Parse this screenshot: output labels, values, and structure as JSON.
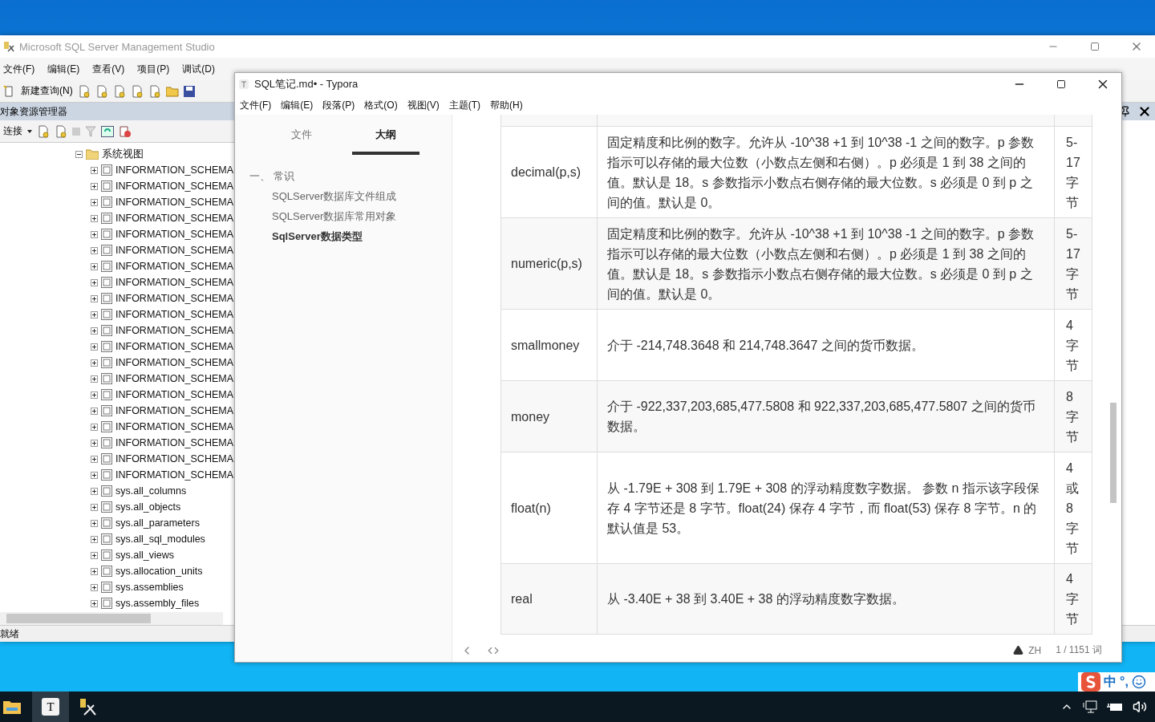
{
  "ssms": {
    "title": "Microsoft SQL Server Management Studio",
    "menu": [
      "文件(F)",
      "编辑(E)",
      "查看(V)",
      "项目(P)",
      "调试(D)"
    ],
    "toolbar": {
      "new_query": "新建查询(N)"
    },
    "object_explorer": {
      "title": "对象资源管理器",
      "connect": "连接",
      "tree": [
        {
          "label": "系统视图",
          "expanded": true,
          "children": [
            {
              "label": "INFORMATION_SCHEMA",
              "expanded": false
            },
            {
              "label": "INFORMATION_SCHEMA",
              "expanded": false
            },
            {
              "label": "INFORMATION_SCHEMA",
              "expanded": false
            },
            {
              "label": "INFORMATION_SCHEMA",
              "expanded": false
            },
            {
              "label": "INFORMATION_SCHEMA",
              "expanded": false
            },
            {
              "label": "INFORMATION_SCHEMA",
              "expanded": false
            },
            {
              "label": "INFORMATION_SCHEMA",
              "expanded": false
            },
            {
              "label": "INFORMATION_SCHEMA",
              "expanded": false
            },
            {
              "label": "INFORMATION_SCHEMA",
              "expanded": false
            },
            {
              "label": "INFORMATION_SCHEMA",
              "expanded": false
            },
            {
              "label": "INFORMATION_SCHEMA",
              "expanded": false
            },
            {
              "label": "INFORMATION_SCHEMA",
              "expanded": false
            },
            {
              "label": "INFORMATION_SCHEMA",
              "expanded": false
            },
            {
              "label": "INFORMATION_SCHEMA",
              "expanded": false
            },
            {
              "label": "INFORMATION_SCHEMA",
              "expanded": false
            },
            {
              "label": "INFORMATION_SCHEMA",
              "expanded": false
            },
            {
              "label": "INFORMATION_SCHEMA",
              "expanded": false
            },
            {
              "label": "INFORMATION_SCHEMA",
              "expanded": false
            },
            {
              "label": "INFORMATION_SCHEMA",
              "expanded": false
            },
            {
              "label": "INFORMATION_SCHEMA",
              "expanded": false
            },
            {
              "label": "sys.all_columns",
              "expanded": false
            },
            {
              "label": "sys.all_objects",
              "expanded": false
            },
            {
              "label": "sys.all_parameters",
              "expanded": false
            },
            {
              "label": "sys.all_sql_modules",
              "expanded": false
            },
            {
              "label": "sys.all_views",
              "expanded": false
            },
            {
              "label": "sys.allocation_units",
              "expanded": false
            },
            {
              "label": "sys.assemblies",
              "expanded": false
            },
            {
              "label": "sys.assembly_files",
              "expanded": false
            }
          ]
        }
      ]
    },
    "status": "就绪"
  },
  "typora": {
    "title": "SQL笔记.md• - Typora",
    "menu": [
      "文件(F)",
      "编辑(E)",
      "段落(P)",
      "格式(O)",
      "视图(V)",
      "主题(T)",
      "帮助(H)"
    ],
    "sidebar": {
      "tabs": [
        {
          "label": "文件",
          "selected": false
        },
        {
          "label": "大纲",
          "selected": true
        }
      ],
      "outline": [
        {
          "label": "一、 常识",
          "selected": false,
          "children": [
            {
              "label": "SQLServer数据库文件组成",
              "selected": false
            },
            {
              "label": "SQLServer数据库常用对象",
              "selected": false
            },
            {
              "label": "SqlServer数据类型",
              "selected": true
            }
          ]
        }
      ]
    },
    "table": {
      "rows": [
        {
          "type": "decimal(p,s)",
          "description": "固定精度和比例的数字。允许从 -10^38 +1 到 10^38 -1 之间的数字。p 参数指示可以存储的最大位数（小数点左侧和右侧）。p 必须是 1 到 38 之间的值。默认是 18。s 参数指示小数点右侧存储的最大位数。s 必须是 0 到 p 之间的值。默认是 0。",
          "size": "5-17字节"
        },
        {
          "type": "numeric(p,s)",
          "description": "固定精度和比例的数字。允许从 -10^38 +1 到 10^38 -1 之间的数字。p 参数指示可以存储的最大位数（小数点左侧和右侧）。p 必须是 1 到 38 之间的值。默认是 18。s 参数指示小数点右侧存储的最大位数。s 必须是 0 到 p 之间的值。默认是 0。",
          "size": "5-17字节"
        },
        {
          "type": "smallmoney",
          "description": "介于 -214,748.3648 和 214,748.3647 之间的货币数据。",
          "size": "4字节"
        },
        {
          "type": "money",
          "description": "介于 -922,337,203,685,477.5808 和 922,337,203,685,477.5807 之间的货币数据。",
          "size": "8字节"
        },
        {
          "type": "float(n)",
          "description": "从 -1.79E + 308 到 1.79E + 308 的浮动精度数字数据。 参数 n 指示该字段保存 4 字节还是 8 字节。float(24) 保存 4 字节，而 float(53) 保存 8 字节。n 的默认值是 53。",
          "size": "4或8字节"
        },
        {
          "type": "real",
          "description": "从 -3.40E + 38 到 3.40E + 38 的浮动精度数字数据。",
          "size": "4字节"
        }
      ]
    },
    "status": {
      "language": "ZH",
      "word_count": "1 / 1151 词"
    }
  },
  "taskbar": {
    "typora_icon": "T"
  },
  "ime": {
    "mode": "中",
    "punctuation": "°,"
  }
}
